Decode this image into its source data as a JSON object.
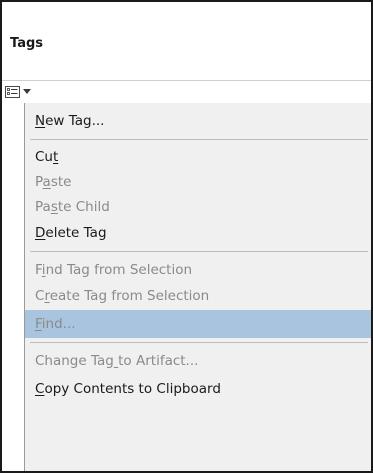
{
  "panel": {
    "title": "Tags",
    "options_icon": "options-list-icon",
    "dropdown_icon": "chevron-down-icon"
  },
  "menu": {
    "items": [
      {
        "label": "New Tag...",
        "mnemonic_index": 0,
        "enabled": true,
        "highlighted": false
      },
      {
        "label": "Cut",
        "mnemonic_index": 2,
        "enabled": true,
        "highlighted": false
      },
      {
        "label": "Paste",
        "mnemonic_index": 1,
        "enabled": false,
        "highlighted": false
      },
      {
        "label": "Paste Child",
        "mnemonic_index": 2,
        "enabled": false,
        "highlighted": false
      },
      {
        "label": "Delete Tag",
        "mnemonic_index": 0,
        "enabled": true,
        "highlighted": false
      },
      {
        "label": "Find Tag from Selection",
        "mnemonic_index": 1,
        "enabled": false,
        "highlighted": false
      },
      {
        "label": "Create Tag from Selection",
        "mnemonic_index": 1,
        "enabled": false,
        "highlighted": false
      },
      {
        "label": "Find...",
        "mnemonic_index": 0,
        "enabled": false,
        "highlighted": true
      },
      {
        "label": "Change Tag to Artifact...",
        "mnemonic_index": 10,
        "enabled": false,
        "highlighted": false
      },
      {
        "label": "Copy Contents to Clipboard",
        "mnemonic_index": 0,
        "enabled": true,
        "highlighted": false
      }
    ]
  },
  "colors": {
    "menu_bg": "#f0f0f0",
    "highlight_bg": "#a9c4de",
    "enabled_text": "#1a1a1a",
    "disabled_text": "#8a8a8a",
    "frame_border": "#1a1a1a"
  }
}
